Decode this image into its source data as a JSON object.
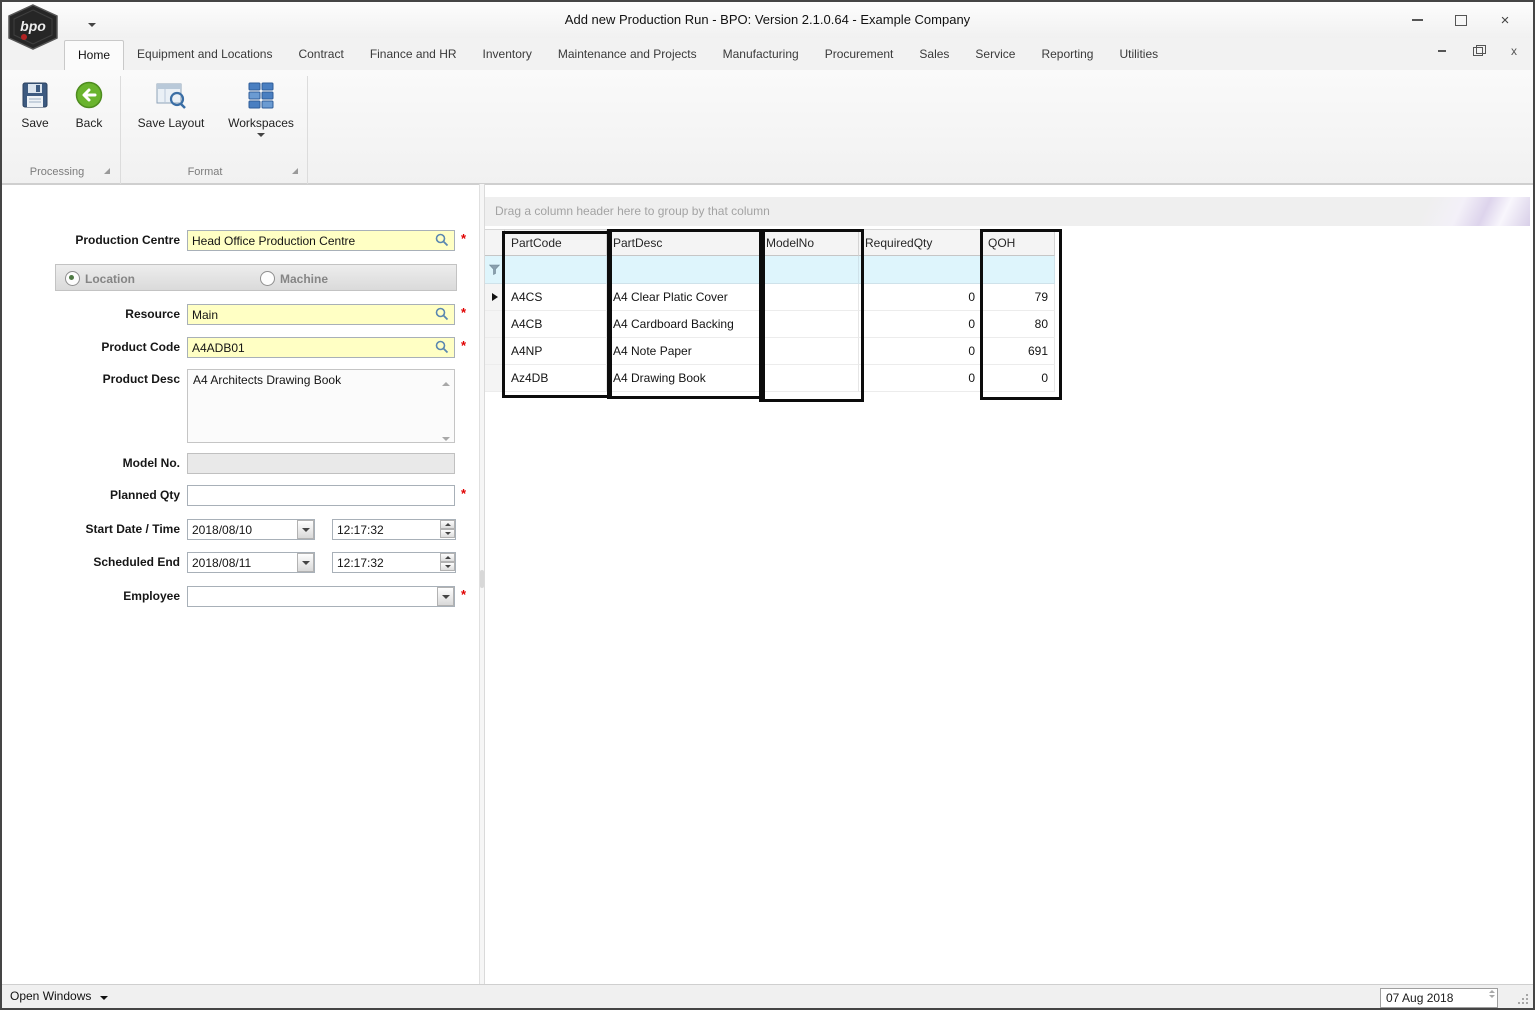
{
  "window": {
    "title": "Add new Production Run - BPO: Version 2.1.0.64 - Example Company",
    "logo_text": "bpo"
  },
  "icons": {
    "close": "×",
    "close_child": "x"
  },
  "menu": {
    "tabs": [
      {
        "label": "Home",
        "active": true
      },
      {
        "label": "Equipment and Locations"
      },
      {
        "label": "Contract"
      },
      {
        "label": "Finance and HR"
      },
      {
        "label": "Inventory"
      },
      {
        "label": "Maintenance and Projects"
      },
      {
        "label": "Manufacturing"
      },
      {
        "label": "Procurement"
      },
      {
        "label": "Sales"
      },
      {
        "label": "Service"
      },
      {
        "label": "Reporting"
      },
      {
        "label": "Utilities"
      }
    ]
  },
  "ribbon": {
    "buttons": [
      {
        "label": "Save"
      },
      {
        "label": "Back"
      },
      {
        "label": "Save Layout"
      },
      {
        "label": "Workspaces"
      }
    ],
    "groups": [
      {
        "label": "Processing"
      },
      {
        "label": "Format"
      }
    ]
  },
  "form": {
    "required_marker": "*",
    "production_centre": {
      "label": "Production Centre",
      "value": "Head Office Production Centre"
    },
    "radio": {
      "location": "Location",
      "machine": "Machine"
    },
    "resource": {
      "label": "Resource",
      "value": "Main"
    },
    "product_code": {
      "label": "Product Code",
      "value": "A4ADB01"
    },
    "product_desc": {
      "label": "Product Desc",
      "value": "A4 Architects Drawing Book"
    },
    "model_no": {
      "label": "Model No.",
      "value": ""
    },
    "planned_qty": {
      "label": "Planned Qty",
      "value": ""
    },
    "start": {
      "label": "Start Date / Time",
      "date": "2018/08/10",
      "time": "12:17:32"
    },
    "end": {
      "label": "Scheduled End",
      "date": "2018/08/11",
      "time": "12:17:32"
    },
    "employee": {
      "label": "Employee",
      "value": ""
    }
  },
  "grid": {
    "group_hint": "Drag a column header here to group by that column",
    "columns": [
      "PartCode",
      "PartDesc",
      "ModelNo",
      "RequiredQty",
      "QOH"
    ],
    "rows": [
      {
        "part_code": "A4CS",
        "part_desc": "A4 Clear Platic Cover",
        "model_no": "",
        "required_qty": "0",
        "qoh": "79"
      },
      {
        "part_code": "A4CB",
        "part_desc": "A4 Cardboard Backing",
        "model_no": "",
        "required_qty": "0",
        "qoh": "80"
      },
      {
        "part_code": "A4NP",
        "part_desc": "A4 Note Paper",
        "model_no": "",
        "required_qty": "0",
        "qoh": "691"
      },
      {
        "part_code": "Az4DB",
        "part_desc": "A4 Drawing Book",
        "model_no": "",
        "required_qty": "0",
        "qoh": "0"
      }
    ]
  },
  "statusbar": {
    "open_windows": "Open Windows",
    "date": "07 Aug 2018"
  },
  "colors": {
    "required_field_bg": "#ffffc4",
    "filter_row_bg": "#def5fc",
    "back_button_green": "#6ab42e",
    "workspaces_blue": "#4a7fc1"
  }
}
